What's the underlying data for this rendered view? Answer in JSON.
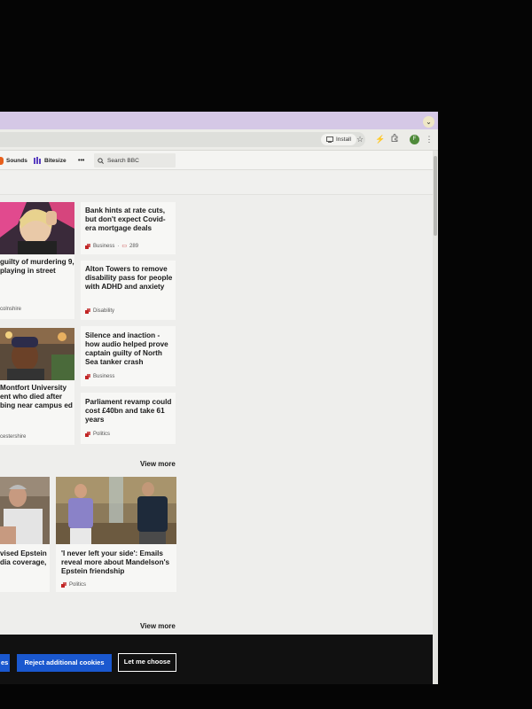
{
  "browser": {
    "install_label": "Install",
    "avatar_initial": "F",
    "chevron": "⌄"
  },
  "nav": {
    "sounds_label": "Sounds",
    "bitesize_label": "Bitesize",
    "more_label": "•••",
    "search_placeholder": "Search BBC"
  },
  "stories": [
    {
      "headline": "Bank hints at rate cuts, but don't expect Covid-era mortgage deals",
      "tag": "Business",
      "comments": "289"
    },
    {
      "headline": "Alton Towers to remove disability pass for people with ADHD and anxiety",
      "tag": "Disability"
    },
    {
      "headline": "Silence and inaction - how audio helped prove captain guilty of North Sea tanker crash",
      "tag": "Business"
    },
    {
      "headline": "Parliament revamp could cost £40bn and take 61 years",
      "tag": "Politics"
    }
  ],
  "left_stories": [
    {
      "headline": "guilty of murdering 9, playing in street",
      "tag": "colnshire"
    },
    {
      "headline": "Montfort University ent who died after bing near campus ed",
      "tag": "cestershire"
    }
  ],
  "view_more_1": "View more",
  "view_more_2": "View more",
  "lower_stories": [
    {
      "headline": "vised Epstein dia coverage,"
    },
    {
      "headline": "'I never left your side': Emails reveal more about Mandelson's Epstein friendship",
      "tag": "Politics"
    }
  ],
  "cookies": {
    "accept_partial": "es",
    "reject_label": "Reject additional cookies",
    "choose_label": "Let me choose"
  },
  "colors": {
    "bbc_red": "#c12525",
    "button_blue": "#1a58cf",
    "browser_accent": "#d5c8e6"
  }
}
